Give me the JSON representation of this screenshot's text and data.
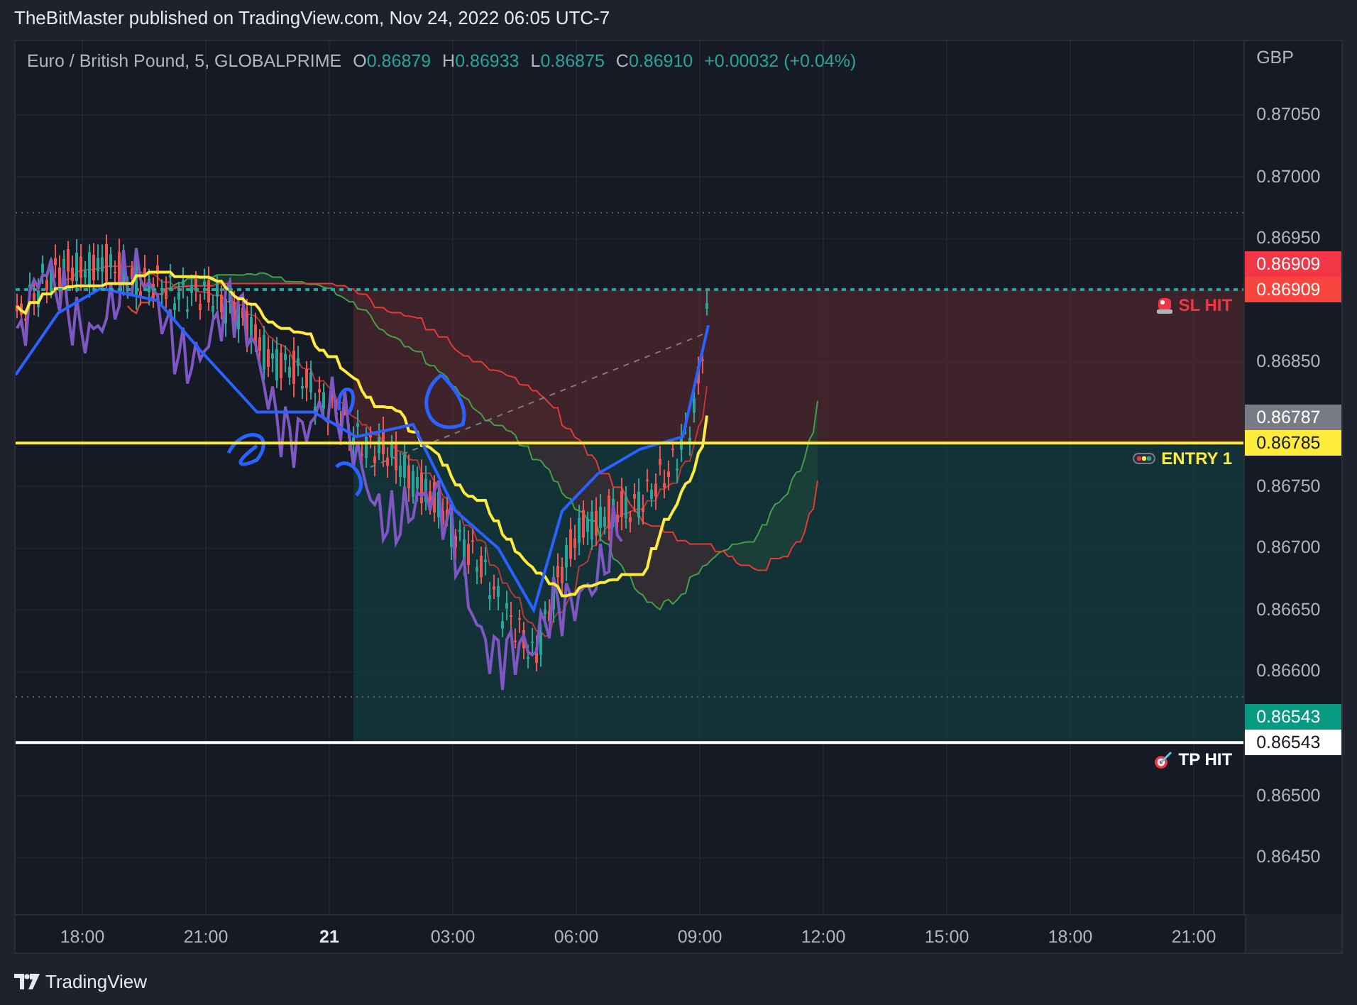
{
  "header": {
    "caption": "TheBitMaster published on TradingView.com, Nov 24, 2022 06:05 UTC-7"
  },
  "legend": {
    "symbol": "Euro / British Pound, 5, GLOBALPRIME",
    "ohlc": [
      {
        "label": "O",
        "value": "0.86879"
      },
      {
        "label": "H",
        "value": "0.86933"
      },
      {
        "label": "L",
        "value": "0.86875"
      },
      {
        "label": "C",
        "value": "0.86910"
      }
    ],
    "change": "+0.00032 (+0.04%)"
  },
  "price_axis": {
    "currency": "GBP",
    "ticks": [
      "0.87050",
      "0.87000",
      "0.86950",
      "0.86850",
      "0.86750",
      "0.86700",
      "0.86650",
      "0.86600",
      "0.86500",
      "0.86450"
    ]
  },
  "price_tags": [
    {
      "text": "0.86909",
      "color": "#f23645"
    },
    {
      "text": "0.86909",
      "color": "#f7453d"
    },
    {
      "text": "0.86787",
      "color": "#787b86"
    },
    {
      "text": "0.86785",
      "color": "#ffeb3b"
    },
    {
      "text": "0.86543",
      "color": "#089981"
    },
    {
      "text": "0.86543",
      "color": "#ffffff"
    }
  ],
  "markers": [
    {
      "kind": "stop",
      "label": "SL HIT"
    },
    {
      "kind": "entry",
      "label": "ENTRY 1"
    },
    {
      "kind": "target",
      "label": "TP HIT"
    }
  ],
  "time_axis": [
    {
      "label": "18:00",
      "kind": "time"
    },
    {
      "label": "21:00",
      "kind": "time"
    },
    {
      "label": "21",
      "kind": "day"
    },
    {
      "label": "03:00",
      "kind": "time"
    },
    {
      "label": "06:00",
      "kind": "time"
    },
    {
      "label": "09:00",
      "kind": "time"
    },
    {
      "label": "12:00",
      "kind": "time"
    },
    {
      "label": "15:00",
      "kind": "time"
    },
    {
      "label": "18:00",
      "kind": "time"
    },
    {
      "label": "21:00",
      "kind": "time"
    }
  ],
  "footer": {
    "brand": "TradingView"
  }
}
